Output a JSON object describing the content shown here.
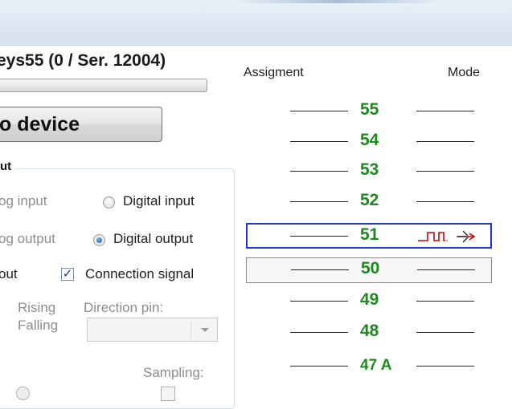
{
  "window": {
    "title": ""
  },
  "device": {
    "title": "eys55 (0 / Ser. 12004)",
    "button_label": "o device"
  },
  "group": {
    "title": "ut",
    "radios": [
      {
        "label": "og input",
        "state": "disabled"
      },
      {
        "label": "Digital input",
        "state": "unchecked"
      },
      {
        "label": "og output",
        "state": "disabled"
      },
      {
        "label": "Digital output",
        "state": "checked"
      }
    ],
    "out_label": "out",
    "connection_signal": {
      "label": "Connection signal",
      "checked": true
    },
    "rising": "Rising",
    "falling": "Falling",
    "direction_pin_label": "Direction pin:",
    "direction_pin_value": "",
    "sampling_label": "Sampling:"
  },
  "table": {
    "header_assignment": "Assigment",
    "header_mode": "Mode",
    "rows": [
      {
        "label": "55",
        "state": "normal",
        "mode": ""
      },
      {
        "label": "54",
        "state": "normal",
        "mode": ""
      },
      {
        "label": "53",
        "state": "normal",
        "mode": ""
      },
      {
        "label": "52",
        "state": "normal",
        "mode": ""
      },
      {
        "label": "51",
        "state": "selected",
        "mode": "pulse-output"
      },
      {
        "label": "50",
        "state": "boxed",
        "mode": ""
      },
      {
        "label": "49",
        "state": "normal",
        "mode": ""
      },
      {
        "label": "48",
        "state": "normal",
        "mode": ""
      },
      {
        "label": "47 A",
        "state": "normal",
        "mode": ""
      }
    ]
  },
  "colors": {
    "pin_number": "#1d8a1d",
    "selection_border": "#1f35d4",
    "pulse_icon": "#d40000"
  }
}
